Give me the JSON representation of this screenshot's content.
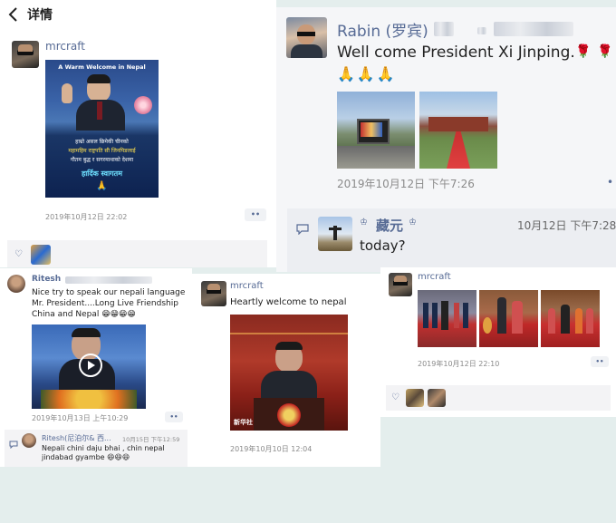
{
  "page": {
    "back_icon": "chevron-left-icon",
    "title": "详情"
  },
  "post_main": {
    "username": "mrcraft",
    "poster_heading": "A Warm Welcome in Nepal",
    "poster_line1": "हाम्रो असल छिमेकी चीनको",
    "poster_line2": "महामहिम राष्ट्रपति सी जिनपिङलाई",
    "poster_line3": "गौतम बुद्ध र सगरमाथाको देशमा",
    "poster_line4": "हार्दिक स्वागतम",
    "timestamp": "2019年10月12日 22:02",
    "more_label": "••"
  },
  "post_rabin": {
    "username": "Rabin (罗宾)",
    "text": "Well come President Xi Jinping.",
    "timestamp": "2019年10月12日 下午7:26",
    "comment_user": "藏元",
    "comment_time": "10月12日 下午7:28",
    "comment_text": "today?"
  },
  "post_ritesh": {
    "username": "Ritesh",
    "text": "Nice try to speak our nepali language Mr. President....Long Live Friendship China and Nepal",
    "emoji": "😁😁😁😁",
    "timestamp": "2019年10月13日 上午10:29",
    "more_label": "••",
    "comment_user": "Ritesh(尼泊尔& 西...",
    "comment_time": "10月15日 下午12:59",
    "comment_text": "Nepali chini daju bhai , chin nepal jindabad gyambe",
    "comment_emoji": "😆😆😆"
  },
  "post_mrcraft2": {
    "username": "mrcraft",
    "text": "Heartly welcome to nepal",
    "timestamp": "2019年10月10日 12:04",
    "watermark": "新华社"
  },
  "post_mrcraft3": {
    "username": "mrcraft",
    "timestamp": "2019年10月12日 22:10",
    "more_label": "••"
  }
}
